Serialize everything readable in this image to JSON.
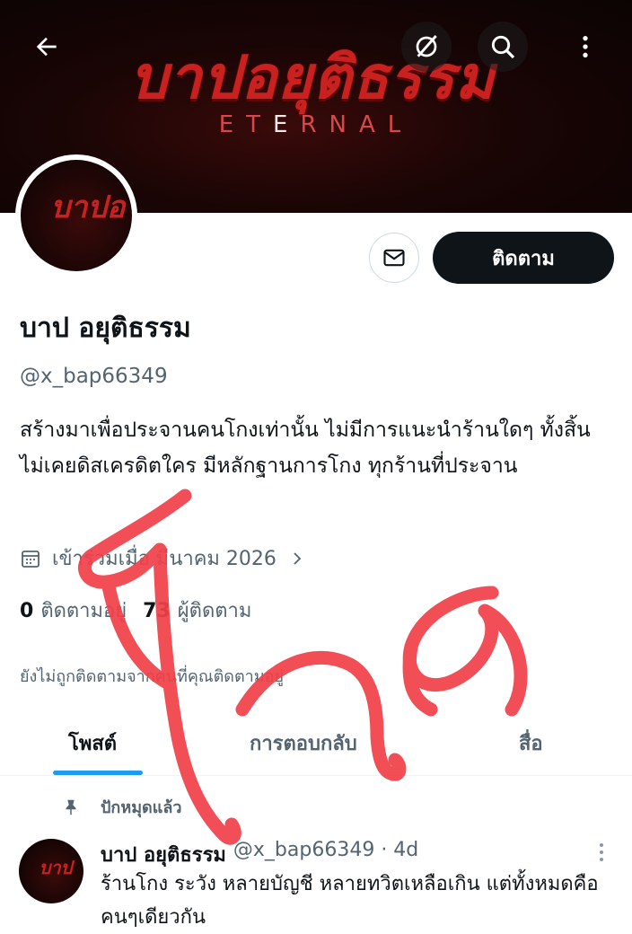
{
  "banner": {
    "title": "บาปอยุติธรรม",
    "subtitle_left": "ET",
    "subtitle_mid": "E",
    "subtitle_right": "RNAL",
    "colors": {
      "accent": "#c9211f",
      "background": "#160404"
    }
  },
  "topbar": {
    "back_icon": "arrow-left-icon",
    "grok_icon": "grok-icon",
    "search_icon": "search-icon",
    "more_icon": "more-vertical-icon"
  },
  "avatar": {
    "text": "บาปอ"
  },
  "actions": {
    "message_icon": "mail-icon",
    "follow_label": "ติดตาม"
  },
  "profile": {
    "display_name": "บาป อยุติธรรม",
    "handle": "@x_bap66349",
    "bio": "สร้างมาเพื่อประจานคนโกงเท่านั้น  ไม่มีการแนะนำร้านใดๆ ทั้งสิ้น  ไม่เคยดิสเครดิตใคร มีหลักฐานการโกง ทุกร้านที่ประจาน",
    "joined": "เข้าร่วมเมื่อ มีนาคม 2026",
    "following_count": "0",
    "following_label": "ติดตามอยู่",
    "followers_count": "73",
    "followers_label": "ผู้ติดตาม",
    "not_followed_note": "ยังไม่ถูกติดตามจากคนที่คุณติดตามอยู่"
  },
  "tabs": [
    {
      "label": "โพสต์",
      "active": true
    },
    {
      "label": "การตอบกลับ",
      "active": false
    },
    {
      "label": "สื่อ",
      "active": false
    }
  ],
  "pinned_label": "ปักหมุดแล้ว",
  "tweet": {
    "avatar_text": "บาป",
    "name": "บาป อยุติธรรม",
    "handle_time": "@x_bap66349 · 4d",
    "text": "ร้านโกง ระวัง หลายบัญชี หลายทวิตเหลือเกิน แต่ทั้งหมดคือคนๆเดียวกัน"
  },
  "overlay": {
    "handwritten_text": "โกง",
    "color": "#f0414a"
  },
  "colors": {
    "link_blue": "#1d9bf0",
    "text_secondary": "#536471",
    "text_primary": "#0f1419"
  }
}
